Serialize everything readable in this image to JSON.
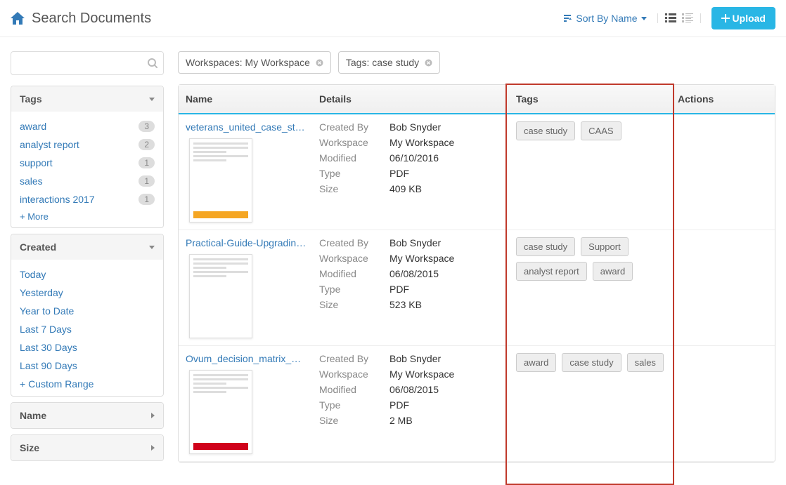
{
  "header": {
    "title": "Search Documents",
    "sort_label": "Sort By Name",
    "upload_label": "Upload"
  },
  "filters": {
    "chips": [
      {
        "label": "Workspaces: My Workspace"
      },
      {
        "label": "Tags: case study"
      }
    ]
  },
  "sidebar": {
    "tags_title": "Tags",
    "tags": [
      {
        "label": "award",
        "count": "3"
      },
      {
        "label": "analyst report",
        "count": "2"
      },
      {
        "label": "support",
        "count": "1"
      },
      {
        "label": "sales",
        "count": "1"
      },
      {
        "label": "interactions 2017",
        "count": "1"
      }
    ],
    "more_label": "+ More",
    "created_title": "Created",
    "created": [
      "Today",
      "Yesterday",
      "Year to Date",
      "Last 7 Days",
      "Last 30 Days",
      "Last 90 Days"
    ],
    "custom_range_label": "+ Custom Range",
    "name_title": "Name",
    "size_title": "Size"
  },
  "columns": {
    "name": "Name",
    "details": "Details",
    "tags": "Tags",
    "actions": "Actions"
  },
  "detail_labels": {
    "created_by": "Created By",
    "workspace": "Workspace",
    "modified": "Modified",
    "type": "Type",
    "size": "Size"
  },
  "rows": [
    {
      "title": "veterans_united_case_stu...",
      "created_by": "Bob Snyder",
      "workspace": "My Workspace",
      "modified": "06/10/2016",
      "type": "PDF",
      "size": "409 KB",
      "tags": [
        "case study",
        "CAAS"
      ],
      "accent": "#f5a623"
    },
    {
      "title": "Practical-Guide-Upgrading...",
      "created_by": "Bob Snyder",
      "workspace": "My Workspace",
      "modified": "06/08/2015",
      "type": "PDF",
      "size": "523 KB",
      "tags": [
        "case study",
        "Support",
        "analyst report",
        "award"
      ],
      "accent": "#ffffff"
    },
    {
      "title": "Ovum_decision_matrix_mu...",
      "created_by": "Bob Snyder",
      "workspace": "My Workspace",
      "modified": "06/08/2015",
      "type": "PDF",
      "size": "2 MB",
      "tags": [
        "award",
        "case study",
        "sales"
      ],
      "accent": "#d0021b"
    }
  ]
}
